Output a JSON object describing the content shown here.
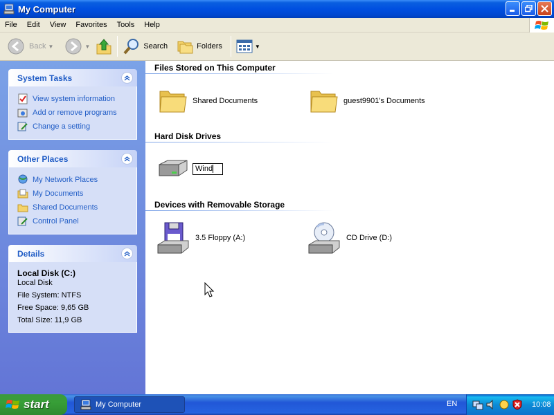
{
  "window": {
    "title": "My Computer"
  },
  "menu": [
    "File",
    "Edit",
    "View",
    "Favorites",
    "Tools",
    "Help"
  ],
  "toolbar": {
    "back": "Back",
    "search": "Search",
    "folders": "Folders"
  },
  "system_tasks": {
    "title": "System Tasks",
    "items": [
      "View system information",
      "Add or remove programs",
      "Change a setting"
    ]
  },
  "other_places": {
    "title": "Other Places",
    "items": [
      "My Network Places",
      "My Documents",
      "Shared Documents",
      "Control Panel"
    ]
  },
  "details": {
    "title": "Details",
    "name": "Local Disk (C:)",
    "type": "Local Disk",
    "fs": "File System: NTFS",
    "free": "Free Space: 9,65 GB",
    "total": "Total Size: 11,9 GB"
  },
  "groups": {
    "files": {
      "title": "Files Stored on This Computer",
      "items": [
        "Shared Documents",
        "guest9901's Documents"
      ]
    },
    "hdd": {
      "title": "Hard Disk Drives",
      "rename_value": "Wind"
    },
    "removable": {
      "title": "Devices with Removable Storage",
      "items": [
        "3.5 Floppy (A:)",
        "CD Drive (D:)"
      ]
    }
  },
  "taskbar": {
    "start": "start",
    "task": "My Computer",
    "lang": "EN",
    "clock": "10:08"
  }
}
